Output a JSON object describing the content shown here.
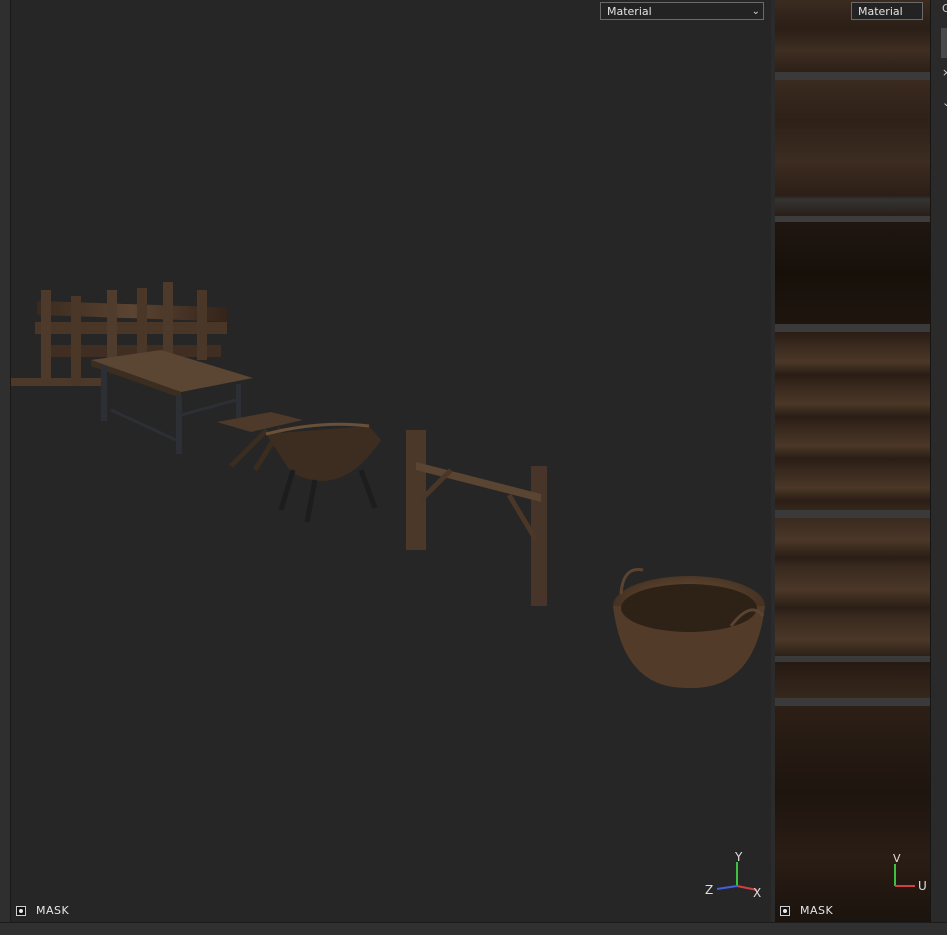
{
  "viewport": {
    "shading_select": "Material",
    "mask_label": "MASK",
    "axes": {
      "y": "Y",
      "z": "Z",
      "x": "X"
    }
  },
  "uv_view": {
    "shading_select": "Material",
    "mask_label": "MASK",
    "axes": {
      "v": "V",
      "u": "U"
    }
  },
  "right_strip": {
    "top_label": "G",
    "glyph_1": "×",
    "glyph_2": "⌄"
  },
  "colors": {
    "wood_dark": "#2a1d14",
    "wood_mid": "#4a3526",
    "basket": "#5a4330",
    "axis_x": "#d04040",
    "axis_y": "#40c040",
    "axis_z": "#4060e0"
  }
}
